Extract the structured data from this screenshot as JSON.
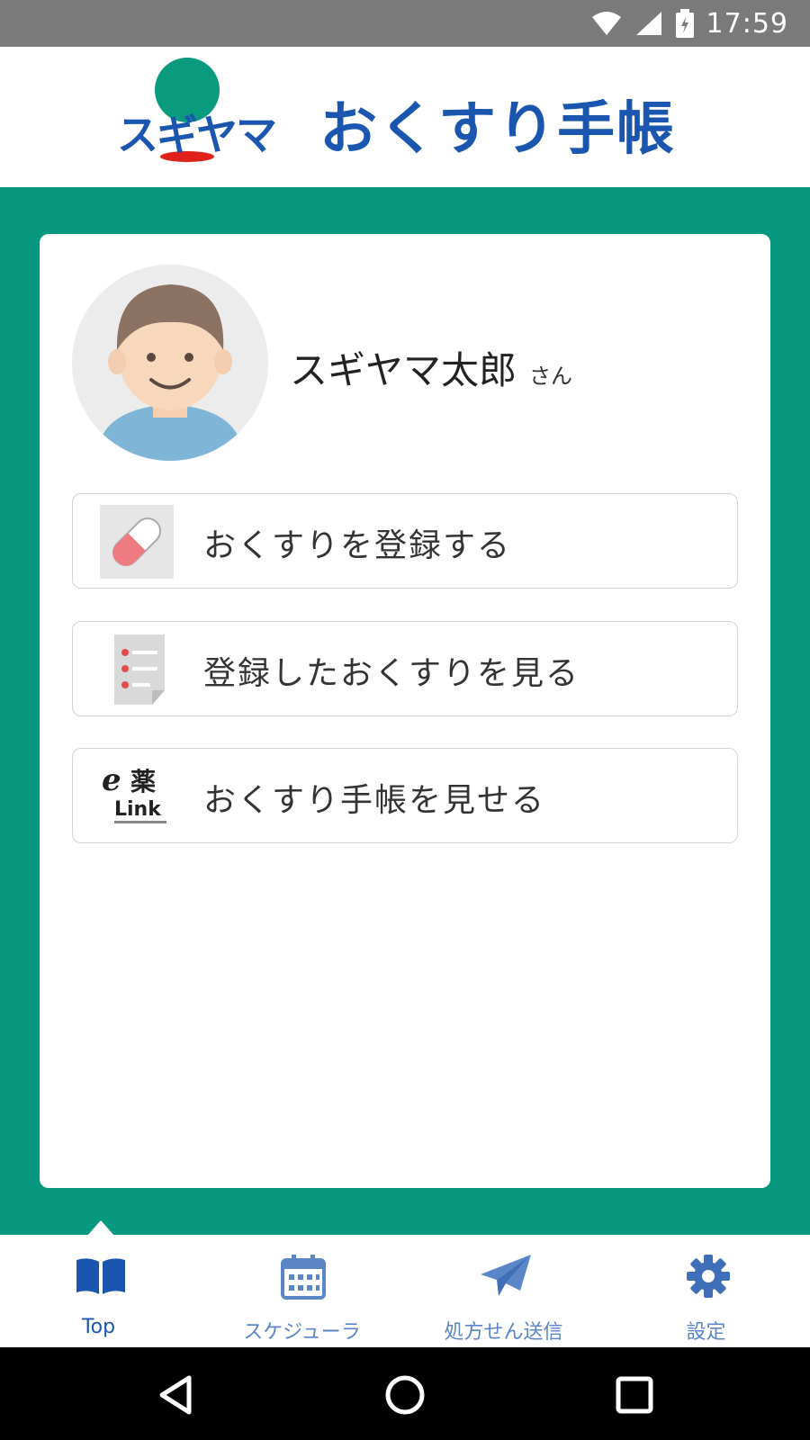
{
  "status": {
    "time": "17:59"
  },
  "header": {
    "logo_text": "スギヤマ",
    "title": "おくすり手帳"
  },
  "profile": {
    "name": "スギヤマ太郎",
    "honorific": "さん"
  },
  "menu": [
    {
      "label": "おくすりを登録する",
      "icon": "pill-icon"
    },
    {
      "label": "登録したおくすりを見る",
      "icon": "checklist-icon"
    },
    {
      "label": "おくすり手帳を見せる",
      "icon": "e-kusuri-link-logo"
    }
  ],
  "nav": [
    {
      "label": "Top",
      "icon": "book-icon",
      "active": true
    },
    {
      "label": "スケジューラ",
      "icon": "calendar-icon",
      "active": false
    },
    {
      "label": "処方せん送信",
      "icon": "paper-plane-icon",
      "active": false
    },
    {
      "label": "設定",
      "icon": "gear-icon",
      "active": false
    }
  ],
  "colors": {
    "teal": "#07987f",
    "brand_blue": "#1a56b0",
    "nav_active": "#1a56b0",
    "nav_inactive": "#5a86c8"
  }
}
